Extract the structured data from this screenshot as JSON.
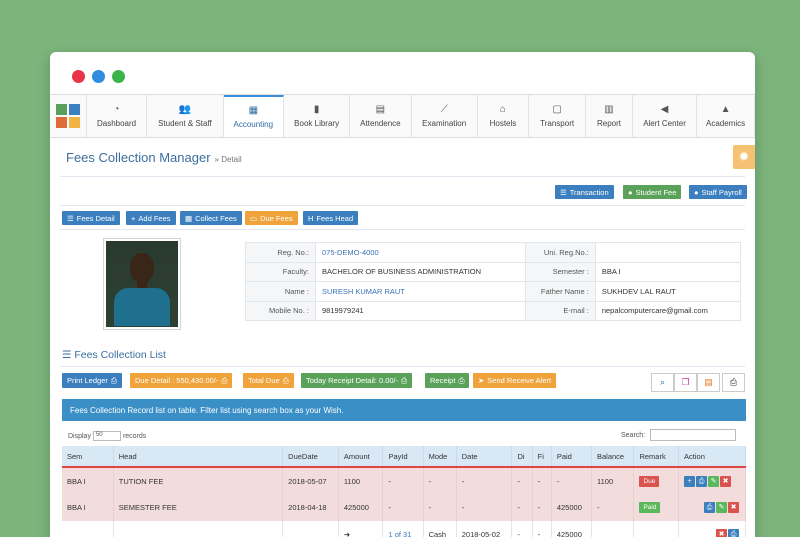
{
  "window": {
    "dots": [
      "#e8334a",
      "#2f8cdf",
      "#3cb44a"
    ]
  },
  "nav": {
    "items": [
      {
        "label": "Dashboard",
        "icon": "dashboard-icon",
        "glyph": "◔",
        "width": 58
      },
      {
        "label": "Student & Staff",
        "icon": "users-icon",
        "glyph": "👥",
        "width": 75
      },
      {
        "label": "Accounting",
        "icon": "calculator-icon",
        "glyph": "▦",
        "width": 58,
        "active": true
      },
      {
        "label": "Book Library",
        "icon": "book-icon",
        "glyph": "▮",
        "width": 64
      },
      {
        "label": "Attendence",
        "icon": "calendar-icon",
        "glyph": "▤",
        "width": 59
      },
      {
        "label": "Examination",
        "icon": "chart-line-icon",
        "glyph": "⟋",
        "width": 64
      },
      {
        "label": "Hostels",
        "icon": "bed-icon",
        "glyph": "⌂",
        "width": 48
      },
      {
        "label": "Transport",
        "icon": "bus-icon",
        "glyph": "▢",
        "width": 54
      },
      {
        "label": "Report",
        "icon": "bar-chart-icon",
        "glyph": "▥",
        "width": 43
      },
      {
        "label": "Alert Center",
        "icon": "bullhorn-icon",
        "glyph": "◀",
        "width": 62
      },
      {
        "label": "Academics",
        "icon": "graduation-cap-icon",
        "glyph": "▲",
        "width": 55
      }
    ]
  },
  "page": {
    "title": "Fees Collection Manager",
    "subtitle": "» Detail"
  },
  "top_actions": {
    "transaction": "Transaction",
    "student_fee": "Student Fee",
    "staff_payroll": "Staff Payroll"
  },
  "tabs": {
    "fees_detail": "Fees Detail",
    "add_fees": "Add Fees",
    "collect_fees": "Collect Fees",
    "due_fees": "Due Fees",
    "fees_head": "Fees Head"
  },
  "student": {
    "reg_no_label": "Reg. No.:",
    "reg_no": "075-DEMO-4000",
    "uni_reg_label": "Uni. Reg.No.:",
    "uni_reg": "",
    "faculty_label": "Faculty:",
    "faculty": "BACHELOR OF BUSINESS ADMINISTRATION",
    "semester_label": "Semester :",
    "semester": "BBA I",
    "name_label": "Name :",
    "name": "SURESH KUMAR RAUT",
    "father_label": "Father Name :",
    "father": "SUKHDEV LAL RAUT",
    "mobile_label": "Mobile No. :",
    "mobile": "9819979241",
    "email_label": "E-mail :",
    "email": "nepalcomputercare@gmail.com"
  },
  "list": {
    "title": "Fees Collection List",
    "print_ledger": "Print Ledger",
    "due_detail": "Due Detail : 550,430.00/-",
    "total_due": "Total Due",
    "today_receipt": "Today Receipt Detail: 0.00/-",
    "receipt": "Receipt",
    "send_alert": "Send Receive Alert",
    "banner": "Fees Collection Record list on table. Filter list using search box as your Wish.",
    "display_label": "Display",
    "display_value": "50",
    "records_label": "records",
    "search_label": "Search:"
  },
  "table": {
    "headers": [
      "Sem",
      "Head",
      "DueDate",
      "Amount",
      "PayId",
      "Mode",
      "Date",
      "Di",
      "Fi",
      "Paid",
      "Balance",
      "Remark",
      "Action"
    ],
    "rows": [
      {
        "sem": "BBA I",
        "head": "TUTION FEE",
        "due": "2018-05-07",
        "amount": "1100",
        "payid": "-",
        "mode": "-",
        "date": "-",
        "di": "-",
        "fi": "-",
        "paid": "-",
        "balance": "1100",
        "remark": "Due"
      },
      {
        "sem": "BBA I",
        "head": "SEMESTER FEE",
        "due": "2018-04-18",
        "amount": "425000",
        "payid": "-",
        "mode": "-",
        "date": "-",
        "di": "-",
        "fi": "-",
        "paid": "425000",
        "balance": "-",
        "remark": "Paid"
      },
      {
        "sem": "",
        "head": "",
        "due": "",
        "amount": "➜",
        "payid": "1 of 31",
        "mode": "Cash",
        "date": "2018-05-02",
        "di": "-",
        "fi": "-",
        "paid": "425000",
        "balance": "",
        "remark": ""
      }
    ]
  },
  "colors": {
    "accent": "#3a8fc6",
    "due": "#d9534f",
    "paid": "#5cb85c",
    "edit": "#5cb85c",
    "delete": "#d9534f"
  }
}
